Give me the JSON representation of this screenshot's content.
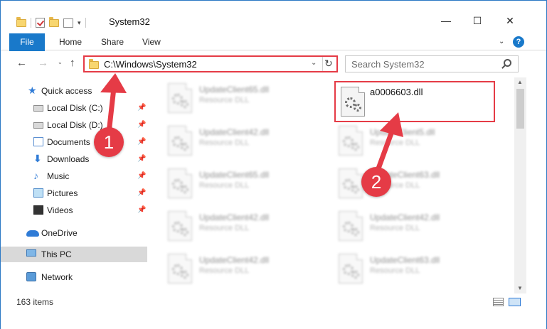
{
  "window": {
    "title": "System32",
    "minimize": "—",
    "maximize": "☐",
    "close": "✕"
  },
  "ribbon": {
    "tabs": [
      "File",
      "Home",
      "Share",
      "View"
    ],
    "help": "?"
  },
  "nav": {
    "back": "←",
    "forward": "→",
    "recent": "⌄",
    "up": "↑",
    "address": "C:\\Windows\\System32",
    "search_placeholder": "Search System32"
  },
  "sidebar": {
    "items": [
      {
        "label": "Quick access",
        "icon": "star-icon",
        "pinned": false
      },
      {
        "label": "Local Disk (C:)",
        "icon": "drive-icon",
        "pinned": true
      },
      {
        "label": "Local Disk (D:)",
        "icon": "drive-icon",
        "pinned": true
      },
      {
        "label": "Documents",
        "icon": "documents-icon",
        "pinned": true
      },
      {
        "label": "Downloads",
        "icon": "download-icon",
        "pinned": true
      },
      {
        "label": "Music",
        "icon": "music-icon",
        "pinned": true
      },
      {
        "label": "Pictures",
        "icon": "pictures-icon",
        "pinned": true
      },
      {
        "label": "Videos",
        "icon": "videos-icon",
        "pinned": true
      },
      {
        "label": "OneDrive",
        "icon": "onedrive-icon",
        "pinned": false
      },
      {
        "label": "This PC",
        "icon": "this-pc-icon",
        "pinned": false,
        "selected": true
      },
      {
        "label": "Network",
        "icon": "network-icon",
        "pinned": false
      }
    ]
  },
  "files": {
    "left_column": [
      {
        "name": "UpdateClient65.dll",
        "type": "Resource DLL"
      },
      {
        "name": "UpdateClient42.dll",
        "type": "Resource DLL"
      },
      {
        "name": "UpdateClient65.dll",
        "type": "Resource DLL"
      },
      {
        "name": "UpdateClient42.dll",
        "type": "Resource DLL"
      },
      {
        "name": "UpdateClient42.dll",
        "type": "Resource DLL"
      }
    ],
    "right_column": [
      {
        "name": "UpdateClient5.dll",
        "type": "Resource DLL"
      },
      {
        "name": "UpdateClient63.dll",
        "type": "Resource DLL"
      },
      {
        "name": "UpdateClient42.dll",
        "type": "Resource DLL"
      },
      {
        "name": "UpdateClient63.dll",
        "type": "Resource DLL"
      }
    ],
    "highlighted": {
      "name": "a0006603.dll"
    }
  },
  "status": {
    "item_count": "163 items"
  },
  "annotations": {
    "step1": "1",
    "step2": "2",
    "color": "#e53b46"
  }
}
